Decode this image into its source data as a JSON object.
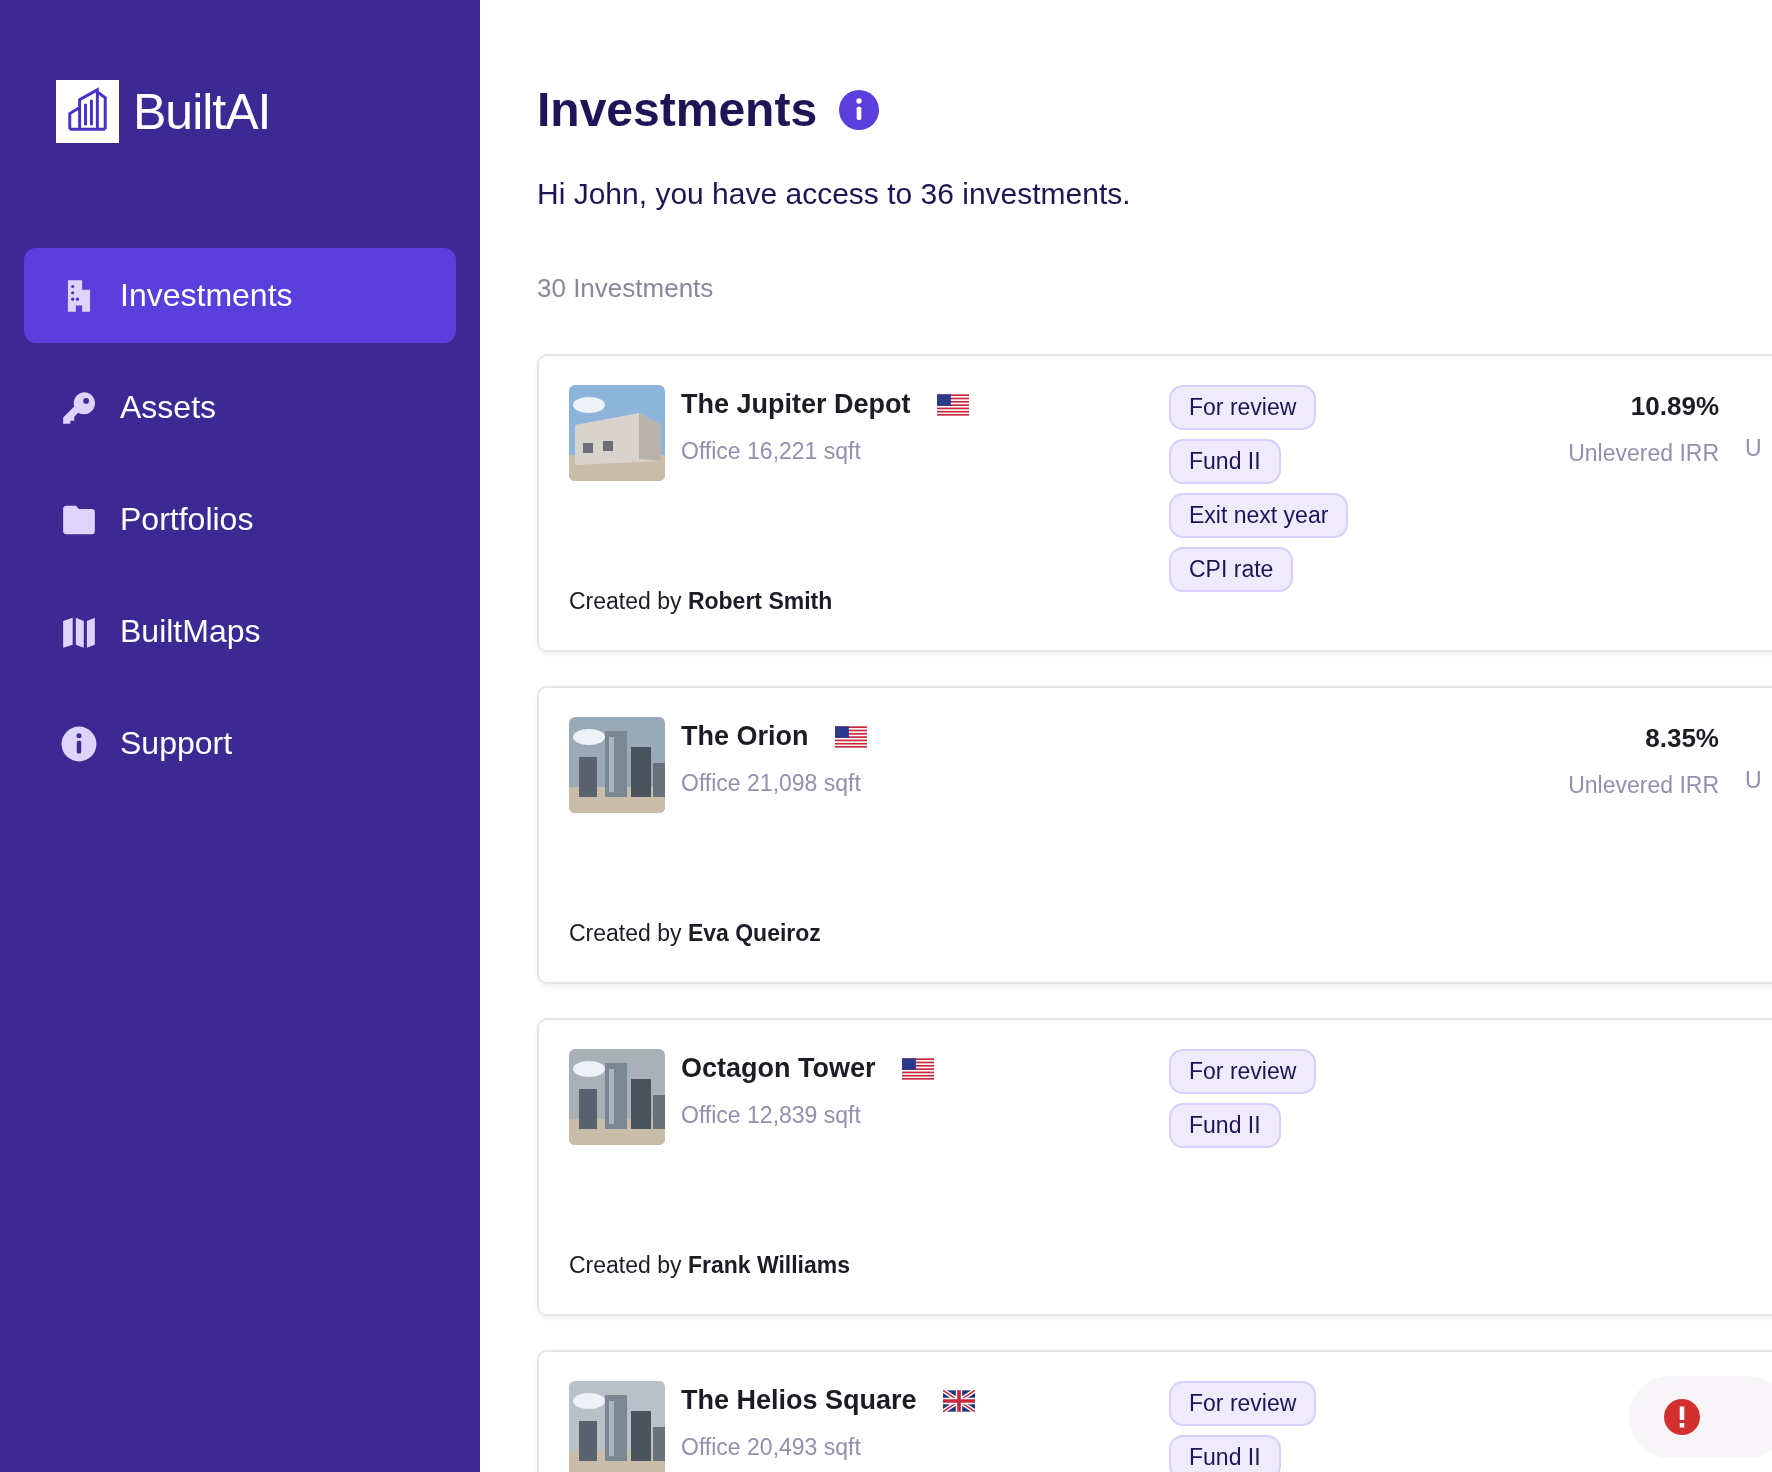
{
  "brand": {
    "name": "BuiltAI"
  },
  "sidebar": {
    "items": [
      {
        "label": "Investments",
        "selected": true
      },
      {
        "label": "Assets",
        "selected": false
      },
      {
        "label": "Portfolios",
        "selected": false
      },
      {
        "label": "BuiltMaps",
        "selected": false
      },
      {
        "label": "Support",
        "selected": false
      }
    ]
  },
  "page": {
    "title": "Investments",
    "greeting": "Hi John, you have access to 36 investments.",
    "count": "30 Investments"
  },
  "investments": [
    {
      "name": "The Jupiter Depot",
      "flag": {
        "kind": "us"
      },
      "subtitle": "Office 16,221 sqft",
      "created_by": "Created by **Robert Smith**",
      "tags": [
        "For review",
        "Fund II",
        "Exit next year",
        "CPI rate"
      ],
      "metric_value": "10.89%",
      "metric_label": "Unlevered IRR",
      "metric_2_label": "U",
      "photo": {
        "kind": "picture"
      }
    },
    {
      "name": "The Orion",
      "flag": {
        "kind": "us"
      },
      "subtitle": "Office 21,098 sqft",
      "created_by": "Created by **Eva Queiroz**",
      "metric_value": "8.35%",
      "metric_label": "Unlevered IRR",
      "metric_2_label": "U",
      "photo": {
        "kind": "picture"
      }
    },
    {
      "name": "Octagon Tower",
      "flag": {
        "kind": "us"
      },
      "subtitle": "Office 12,839 sqft",
      "created_by": "Created by **Frank Williams**",
      "tags": [
        "For review",
        "Fund II"
      ],
      "photo": {
        "kind": "picture"
      }
    },
    {
      "name": "The Helios Square",
      "flag": {
        "kind": "uk"
      },
      "subtitle": "Office 20,493 sqft",
      "tags": [
        "For review",
        "Fund II"
      ],
      "photo": {
        "kind": "picture"
      }
    }
  ]
}
